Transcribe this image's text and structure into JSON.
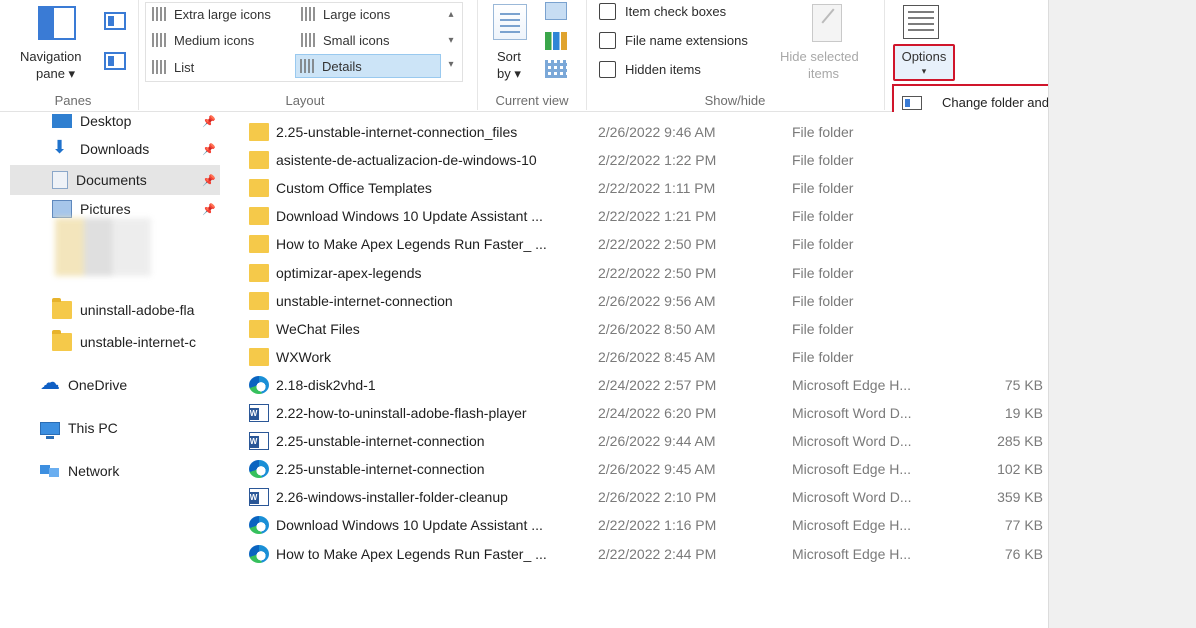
{
  "ribbon": {
    "panes": {
      "group_label": "Panes",
      "nav_pane_label_1": "Navigation",
      "nav_pane_label_2": "pane ▾"
    },
    "layout": {
      "group_label": "Layout",
      "items": [
        {
          "label": "Extra large icons"
        },
        {
          "label": "Large icons"
        },
        {
          "label": "Medium icons"
        },
        {
          "label": "Small icons"
        },
        {
          "label": "List"
        },
        {
          "label": "Details"
        }
      ]
    },
    "current_view": {
      "group_label": "Current view",
      "sort_label_1": "Sort",
      "sort_label_2": "by ▾"
    },
    "show_hide": {
      "group_label": "Show/hide",
      "item_check_boxes": "Item check boxes",
      "file_name_extensions": "File name extensions",
      "hidden_items": "Hidden items",
      "hide_selected_1": "Hide selected",
      "hide_selected_2": "items"
    },
    "options": {
      "label": "Options",
      "arrow": "▾"
    }
  },
  "dropdown": {
    "item_label": "Change folder and search options"
  },
  "nav": {
    "items": [
      {
        "label": "Desktop",
        "icon": "desktop-icon"
      },
      {
        "label": "Downloads",
        "icon": "downloads-icon"
      },
      {
        "label": "Documents",
        "icon": "documents-icon"
      },
      {
        "label": "Pictures",
        "icon": "pictures-icon"
      },
      {
        "label": "uninstall-adobe-fla",
        "icon": "folder-icon"
      },
      {
        "label": "unstable-internet-c",
        "icon": "folder-icon"
      },
      {
        "label": "OneDrive",
        "icon": "onedrive-icon"
      },
      {
        "label": "This PC",
        "icon": "this-pc-icon"
      },
      {
        "label": "Network",
        "icon": "network-icon"
      }
    ],
    "pin_glyph": "📌"
  },
  "files": [
    {
      "name": "2.25-unstable-internet-connection_files",
      "date": "2/26/2022 9:46 AM",
      "type": "File folder",
      "size": "",
      "icon": "folder"
    },
    {
      "name": "asistente-de-actualizacion-de-windows-10",
      "date": "2/22/2022 1:22 PM",
      "type": "File folder",
      "size": "",
      "icon": "folder"
    },
    {
      "name": "Custom Office Templates",
      "date": "2/22/2022 1:11 PM",
      "type": "File folder",
      "size": "",
      "icon": "folder"
    },
    {
      "name": "Download Windows 10 Update Assistant ...",
      "date": "2/22/2022 1:21 PM",
      "type": "File folder",
      "size": "",
      "icon": "folder"
    },
    {
      "name": "How to Make Apex Legends Run Faster_ ...",
      "date": "2/22/2022 2:50 PM",
      "type": "File folder",
      "size": "",
      "icon": "folder"
    },
    {
      "name": "optimizar-apex-legends",
      "date": "2/22/2022 2:50 PM",
      "type": "File folder",
      "size": "",
      "icon": "folder"
    },
    {
      "name": "unstable-internet-connection",
      "date": "2/26/2022 9:56 AM",
      "type": "File folder",
      "size": "",
      "icon": "folder"
    },
    {
      "name": "WeChat Files",
      "date": "2/26/2022 8:50 AM",
      "type": "File folder",
      "size": "",
      "icon": "folder"
    },
    {
      "name": "WXWork",
      "date": "2/26/2022 8:45 AM",
      "type": "File folder",
      "size": "",
      "icon": "folder"
    },
    {
      "name": "2.18-disk2vhd-1",
      "date": "2/24/2022 2:57 PM",
      "type": "Microsoft Edge H...",
      "size": "75 KB",
      "icon": "edge"
    },
    {
      "name": "2.22-how-to-uninstall-adobe-flash-player",
      "date": "2/24/2022 6:20 PM",
      "type": "Microsoft Word D...",
      "size": "19 KB",
      "icon": "word"
    },
    {
      "name": "2.25-unstable-internet-connection",
      "date": "2/26/2022 9:44 AM",
      "type": "Microsoft Word D...",
      "size": "285 KB",
      "icon": "word"
    },
    {
      "name": "2.25-unstable-internet-connection",
      "date": "2/26/2022 9:45 AM",
      "type": "Microsoft Edge H...",
      "size": "102 KB",
      "icon": "edge"
    },
    {
      "name": "2.26-windows-installer-folder-cleanup",
      "date": "2/26/2022 2:10 PM",
      "type": "Microsoft Word D...",
      "size": "359 KB",
      "icon": "word"
    },
    {
      "name": "Download Windows 10 Update Assistant ...",
      "date": "2/22/2022 1:16 PM",
      "type": "Microsoft Edge H...",
      "size": "77 KB",
      "icon": "edge"
    },
    {
      "name": "How to Make Apex Legends Run Faster_ ...",
      "date": "2/22/2022 2:44 PM",
      "type": "Microsoft Edge H...",
      "size": "76 KB",
      "icon": "edge"
    }
  ],
  "colors": {
    "highlight_red": "#d0152b",
    "selection_blue": "#cce4f7",
    "folder_yellow": "#f5c94a"
  }
}
